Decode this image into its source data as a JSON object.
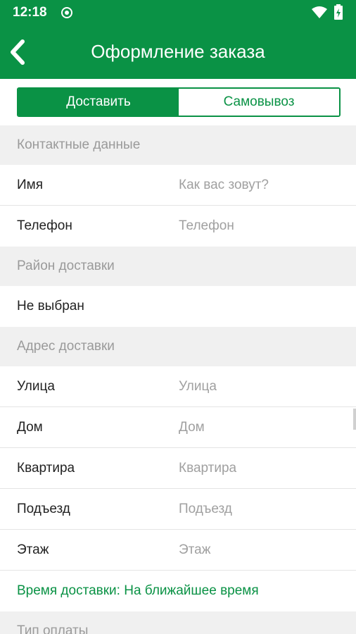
{
  "status": {
    "time": "12:18"
  },
  "appbar": {
    "title": "Оформление заказа"
  },
  "tabs": [
    {
      "label": "Доставить",
      "active": true
    },
    {
      "label": "Самовывоз",
      "active": false
    }
  ],
  "contact": {
    "header": "Контактные данные",
    "name_label": "Имя",
    "name_placeholder": "Как вас зовут?",
    "phone_label": "Телефон",
    "phone_placeholder": "Телефон"
  },
  "district": {
    "header": "Район доставки",
    "value": "Не выбран"
  },
  "address": {
    "header": "Адрес доставки",
    "street_label": "Улица",
    "street_placeholder": "Улица",
    "house_label": "Дом",
    "house_placeholder": "Дом",
    "apartment_label": "Квартира",
    "apartment_placeholder": "Квартира",
    "entrance_label": "Подъезд",
    "entrance_placeholder": "Подъезд",
    "floor_label": "Этаж",
    "floor_placeholder": "Этаж"
  },
  "delivery_time": {
    "text": "Время доставки: На ближайшее время"
  },
  "payment": {
    "header": "Тип оплаты"
  },
  "colors": {
    "brand_green": "#0a9245",
    "section_bg": "#f0f0f0",
    "muted_text": "#9a9a9a"
  }
}
